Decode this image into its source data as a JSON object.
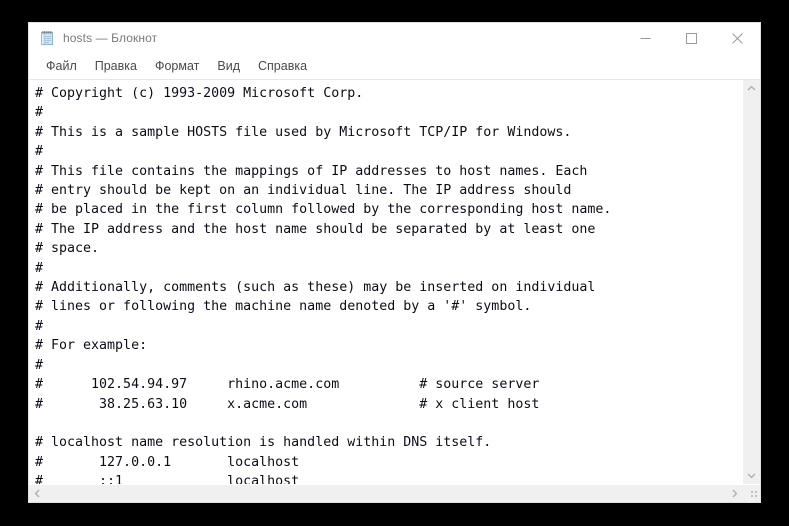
{
  "window": {
    "title": "hosts — Блокнот",
    "icon": "notepad-icon",
    "controls": {
      "minimize": "—",
      "maximize": "□",
      "close": "✕"
    }
  },
  "menu": {
    "items": [
      {
        "label": "Файл"
      },
      {
        "label": "Правка"
      },
      {
        "label": "Формат"
      },
      {
        "label": "Вид"
      },
      {
        "label": "Справка"
      }
    ]
  },
  "editor": {
    "content": "# Copyright (c) 1993-2009 Microsoft Corp.\n#\n# This is a sample HOSTS file used by Microsoft TCP/IP for Windows.\n#\n# This file contains the mappings of IP addresses to host names. Each\n# entry should be kept on an individual line. The IP address should\n# be placed in the first column followed by the corresponding host name.\n# The IP address and the host name should be separated by at least one\n# space.\n#\n# Additionally, comments (such as these) may be inserted on individual\n# lines or following the machine name denoted by a '#' symbol.\n#\n# For example:\n#\n#      102.54.94.97     rhino.acme.com          # source server\n#       38.25.63.10     x.acme.com              # x client host\n\n# localhost name resolution is handled within DNS itself.\n#       127.0.0.1       localhost\n#       ::1             localhost\n"
  },
  "scrollbars": {
    "vertical": {
      "up_arrow": "⌃",
      "down_arrow": "⌄"
    },
    "horizontal": {
      "left_arrow": "‹",
      "right_arrow": "›"
    }
  },
  "colors": {
    "desktop_background": "#000000",
    "window_background": "#ffffff",
    "title_text": "#7a7a7a",
    "menu_text": "#4a4a4a",
    "editor_text": "#0d0d1a",
    "scrollbar_track": "#f0f0f0",
    "scrollbar_arrow": "#a0a0a0"
  }
}
